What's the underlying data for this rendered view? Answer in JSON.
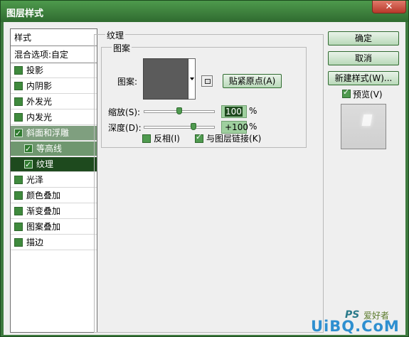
{
  "window": {
    "title": "图层样式",
    "close_glyph": "✕"
  },
  "styles_list": {
    "header": "样式",
    "blend_options": "混合选项:自定",
    "items": [
      {
        "label": "投影",
        "checked": false
      },
      {
        "label": "内阴影",
        "checked": false
      },
      {
        "label": "外发光",
        "checked": false
      },
      {
        "label": "内发光",
        "checked": false
      },
      {
        "label": "斜面和浮雕",
        "checked": true
      },
      {
        "label": "等高线",
        "checked": true
      },
      {
        "label": "纹理",
        "checked": true
      },
      {
        "label": "光泽",
        "checked": false
      },
      {
        "label": "颜色叠加",
        "checked": false
      },
      {
        "label": "渐变叠加",
        "checked": false
      },
      {
        "label": "图案叠加",
        "checked": false
      },
      {
        "label": "描边",
        "checked": false
      }
    ]
  },
  "texture": {
    "group_title": "纹理",
    "pattern_group_title": "图案",
    "pattern_label": "图案:",
    "snap_button": {
      "text": "贴紧原点",
      "hotkey": "(A)"
    },
    "scale": {
      "label": "缩放",
      "hotkey": "(S)",
      "colon": ":",
      "value": "100",
      "unit": "%",
      "level": 0.5
    },
    "depth": {
      "label": "深度",
      "hotkey": "(D)",
      "colon": ":",
      "value": "+100",
      "unit": "%",
      "level": 0.7
    },
    "invert": {
      "label": "反相",
      "hotkey": "(I)",
      "checked": false
    },
    "link": {
      "label": "与图层链接",
      "hotkey": "(K)",
      "checked": true
    }
  },
  "buttons": {
    "ok": "确定",
    "cancel": "取消",
    "new_style": {
      "text": "新建样式",
      "hotkey": "(W)...",
      "ul": "W"
    },
    "preview": {
      "label": "预览",
      "hotkey": "(V)",
      "checked": true
    }
  },
  "watermark": {
    "logo": "PS",
    "cn": "爱好者",
    "url": "UiBQ.CoM"
  },
  "colors": {
    "title_bar": "#3e7a3f",
    "selected_dark": "#1e4a1e",
    "accent": "#4f9a4f"
  }
}
